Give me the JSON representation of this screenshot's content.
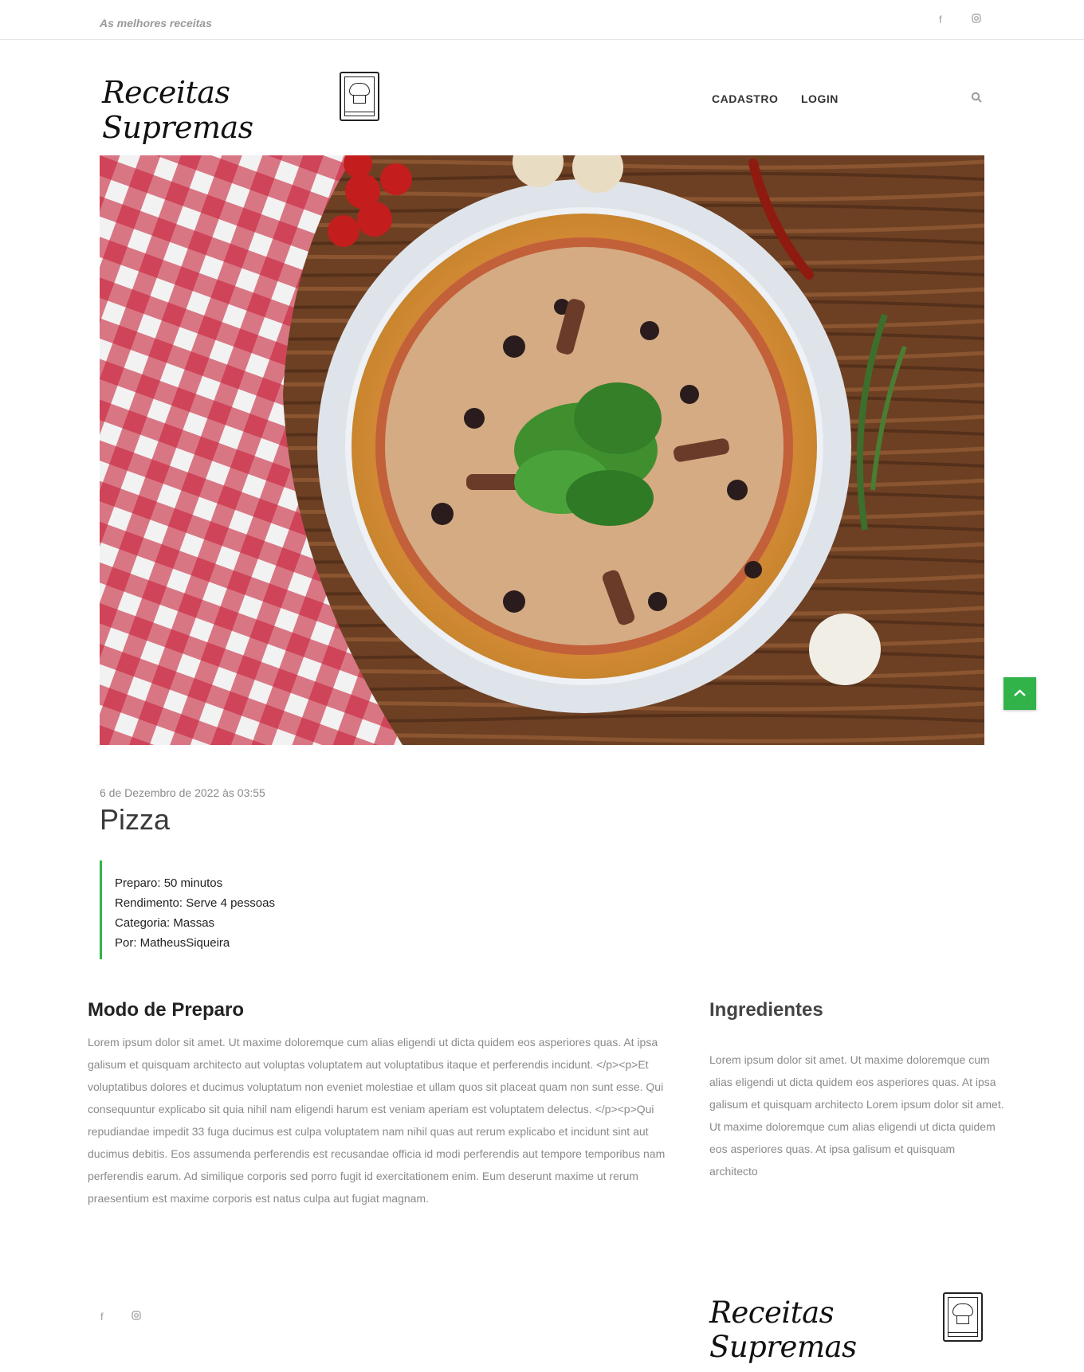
{
  "topbar": {
    "tagline": "As melhores receitas",
    "social": [
      "facebook-icon",
      "instagram-icon"
    ]
  },
  "header": {
    "logo_text": "Receitas Supremas",
    "nav": [
      "CADASTRO",
      "LOGIN"
    ],
    "search_icon": "search-icon"
  },
  "hero": {
    "alt": "Pizza"
  },
  "post": {
    "date": "6 de Dezembro de 2022 às 03:55",
    "title": "Pizza",
    "info": [
      "Preparo: 50 minutos",
      "Rendimento: Serve 4 pessoas",
      "Categoria: Massas",
      "Por: MatheusSiqueira"
    ]
  },
  "preparo": {
    "title": "Modo de Preparo",
    "text": "Lorem ipsum dolor sit amet. Ut maxime doloremque cum alias eligendi ut dicta quidem eos asperiores quas. At ipsa galisum et quisquam architecto aut voluptas voluptatem aut voluptatibus itaque et perferendis incidunt. </p><p>Et voluptatibus dolores et ducimus voluptatum non eveniet molestiae et ullam quos sit placeat quam non sunt esse. Qui consequuntur explicabo sit quia nihil nam eligendi harum est veniam aperiam est voluptatem delectus. </p><p>Qui repudiandae impedit 33 fuga ducimus est culpa voluptatem nam nihil quas aut rerum explicabo et incidunt sint aut ducimus debitis. Eos assumenda perferendis est recusandae officia id modi perferendis aut tempore temporibus nam perferendis earum. Ad similique corporis sed porro fugit id exercitationem enim. Eum deserunt maxime ut rerum praesentium est maxime corporis est natus culpa aut fugiat magnam."
  },
  "ingredientes": {
    "title": "Ingredientes",
    "text": "Lorem ipsum dolor sit amet. Ut maxime doloremque cum alias eligendi ut dicta quidem eos asperiores quas. At ipsa galisum et quisquam architecto Lorem ipsum dolor sit amet. Ut maxime doloremque cum alias eligendi ut dicta quidem eos asperiores quas. At ipsa galisum et quisquam architecto"
  },
  "footer": {
    "logo_text": "Receitas Supremas",
    "social": [
      "facebook-icon",
      "instagram-icon"
    ]
  },
  "colors": {
    "accent": "#32b34a",
    "muted_text": "#8a8a8a",
    "heading": "#222222"
  }
}
